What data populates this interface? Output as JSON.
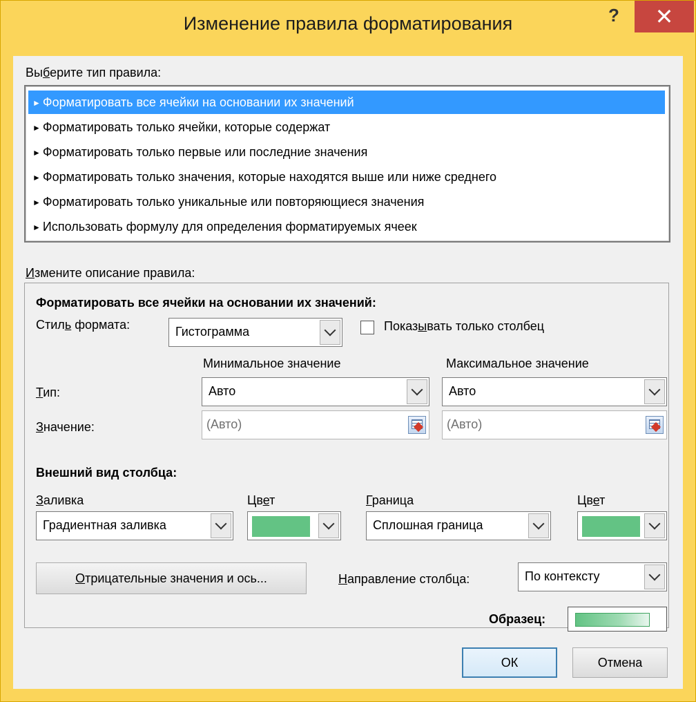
{
  "window": {
    "title": "Изменение правила форматирования",
    "help_label": "?",
    "close_label": "✕"
  },
  "rule_type": {
    "label_pre": "Вы",
    "label_key": "б",
    "label_post": "ерите тип правила:",
    "items": [
      {
        "label": "Форматировать все ячейки на основании их значений",
        "selected": true
      },
      {
        "label": "Форматировать только ячейки, которые содержат",
        "selected": false
      },
      {
        "label": "Форматировать только первые или последние значения",
        "selected": false
      },
      {
        "label": "Форматировать только значения, которые находятся выше или ниже среднего",
        "selected": false
      },
      {
        "label": "Форматировать только уникальные или повторяющиеся значения",
        "selected": false
      },
      {
        "label": "Использовать формулу для определения форматируемых ячеек",
        "selected": false
      }
    ]
  },
  "description": {
    "label_key": "И",
    "label_post": "змените описание правила:",
    "heading": "Форматировать все ячейки на основании их значений:",
    "format_style_pre": "Стил",
    "format_style_key": "ь",
    "format_style_post": " формата:",
    "format_style_value": "Гистограмма",
    "show_bar_only_pre": "Показ",
    "show_bar_only_key": "ы",
    "show_bar_only_post": "вать только столбец",
    "min_header": "Минимальное значение",
    "max_header": "Максимальное значение",
    "type_key": "Т",
    "type_post": "ип:",
    "value_key": "З",
    "value_post": "начение:",
    "min_type": "Авто",
    "max_type": "Авто",
    "min_value": "(Авто)",
    "max_value": "(Авто)",
    "bar_appearance": "Внешний вид столбца:",
    "fill_key": "З",
    "fill_post": "аливка",
    "color_pre": "Цв",
    "color_key": "е",
    "color_post": "т",
    "border_key": "Г",
    "border_post": "раница",
    "fill_value": "Градиентная заливка",
    "border_value": "Сплошная граница",
    "fill_color": "#63c384",
    "border_color": "#63c384",
    "negative_key": "О",
    "negative_post": "трицательные значения и ось...",
    "direction_key": "Н",
    "direction_post": "аправление столбца:",
    "direction_value": "По контексту",
    "preview_label": "Образец:"
  },
  "buttons": {
    "ok": "ОК",
    "cancel": "Отмена"
  }
}
